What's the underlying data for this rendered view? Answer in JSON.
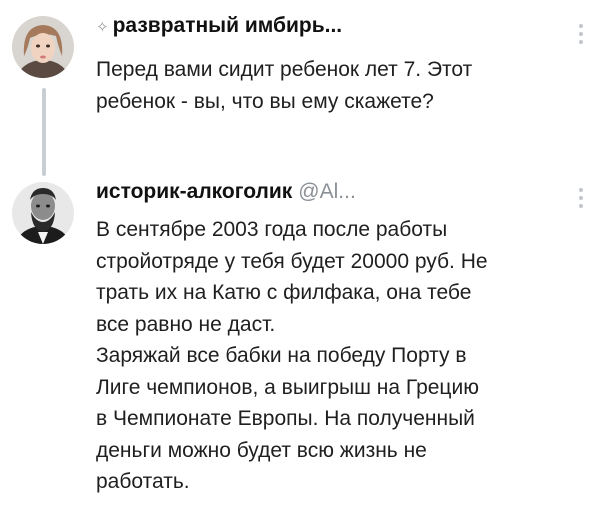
{
  "tweets": [
    {
      "author": "развратный имбирь...",
      "author_prefix": "✧",
      "handle": "",
      "text": "Перед вами сидит ребенок лет 7. Этот\nребенок - вы, что вы ему скажете?",
      "avatar_icon": "girl-portrait-avatar",
      "menu_icon": "more-options-icon"
    },
    {
      "author": "историк-алкоголик",
      "handle": "@Al...",
      "text": "В сентябре 2003 года после работы\nстройотряде у тебя будет 20000 руб. Не\nтрать их на Катю с  филфака, она тебе\nвсе равно не даст.\nЗаряжай все бабки на победу Порту в\nЛиге чемпионов, а выигрыш на Грецию\nв Чемпионате Европы. На полученный\nденьги можно будет всю жизнь не\nработать.",
      "avatar_icon": "bearded-man-portrait-avatar",
      "menu_icon": "more-options-icon"
    }
  ],
  "colors": {
    "text": "#1f1f1f",
    "handle": "#8a9096",
    "thread_line": "#c9ced3"
  }
}
